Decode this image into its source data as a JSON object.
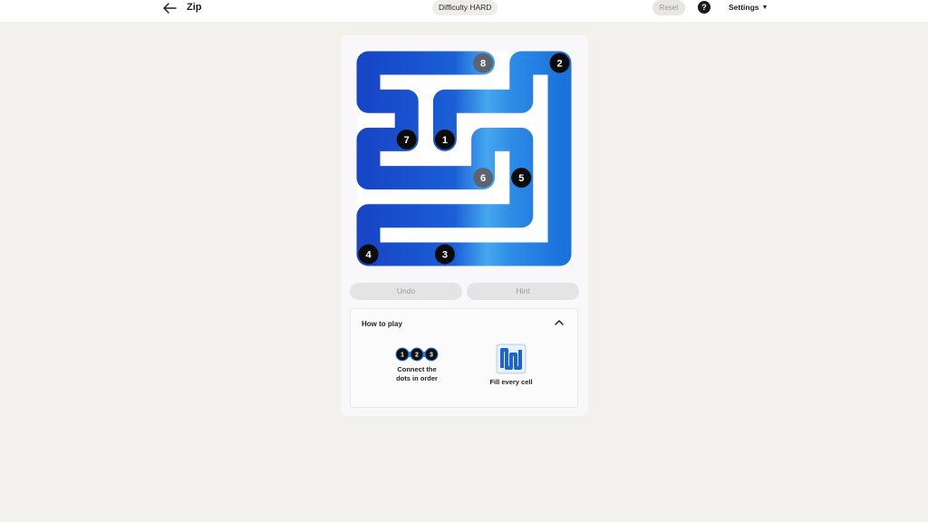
{
  "header": {
    "title": "Zip",
    "difficulty": "Difficulty HARD",
    "reset_label": "Reset",
    "help_label": "?",
    "settings_label": "Settings"
  },
  "board": {
    "grid_size": 6,
    "path_color": "#1f6fd8",
    "numbers": [
      {
        "label": "1",
        "row": 2,
        "col": 2,
        "state": "done"
      },
      {
        "label": "2",
        "row": 0,
        "col": 5,
        "state": "done"
      },
      {
        "label": "3",
        "row": 5,
        "col": 2,
        "state": "done"
      },
      {
        "label": "4",
        "row": 5,
        "col": 0,
        "state": "done"
      },
      {
        "label": "5",
        "row": 3,
        "col": 4,
        "state": "done"
      },
      {
        "label": "6",
        "row": 3,
        "col": 3,
        "state": "dim"
      },
      {
        "label": "7",
        "row": 2,
        "col": 1,
        "state": "done"
      },
      {
        "label": "8",
        "row": 0,
        "col": 3,
        "state": "dim"
      }
    ],
    "path": [
      [
        2,
        2
      ],
      [
        1,
        2
      ],
      [
        1,
        3
      ],
      [
        1,
        4
      ],
      [
        0,
        4
      ],
      [
        0,
        5
      ],
      [
        1,
        5
      ],
      [
        2,
        5
      ],
      [
        3,
        5
      ],
      [
        4,
        5
      ],
      [
        5,
        5
      ],
      [
        5,
        4
      ],
      [
        5,
        3
      ],
      [
        5,
        2
      ],
      [
        5,
        1
      ],
      [
        5,
        0
      ],
      [
        4,
        0
      ],
      [
        4,
        1
      ],
      [
        4,
        2
      ],
      [
        4,
        3
      ],
      [
        4,
        4
      ],
      [
        3,
        4
      ],
      [
        2,
        4
      ],
      [
        2,
        3
      ],
      [
        3,
        3
      ],
      [
        3,
        2
      ],
      [
        3,
        1
      ],
      [
        3,
        0
      ],
      [
        2,
        0
      ],
      [
        2,
        1
      ],
      [
        1,
        1
      ],
      [
        1,
        0
      ],
      [
        0,
        0
      ],
      [
        0,
        1
      ],
      [
        0,
        2
      ],
      [
        0,
        3
      ]
    ]
  },
  "controls": {
    "undo_label": "Undo",
    "hint_label": "Hint"
  },
  "how_to_play": {
    "title": "How to play",
    "step1_label": "Connect the dots in order",
    "step1_line1": "Connect the",
    "step1_line2": "dots in order",
    "step1_dots": [
      "1",
      "2",
      "3"
    ],
    "step2_label": "Fill every cell"
  }
}
